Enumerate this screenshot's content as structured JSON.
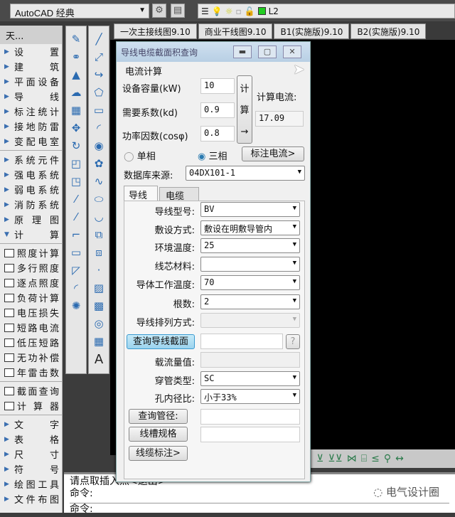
{
  "toolbar": {
    "workspace": "AutoCAD 经典",
    "layer": "L2",
    "icons": [
      "gear-icon",
      "workspace-icon",
      "layer-manager-icon",
      "bulb-icon",
      "sun-icon",
      "freeze-icon",
      "lock-icon",
      "color-swatch-icon"
    ],
    "layer_color": "#22cc22"
  },
  "tabs": [
    "一次主接线图9.10",
    "商业干线图9.10",
    "B1(实施版)9.10",
    "B2(实施版)9.10"
  ],
  "left_panel": {
    "title": "天...",
    "group1": [
      "设 置",
      "建 筑",
      "平面设备",
      "导 线",
      "标注统计",
      "接地防雷",
      "变配电室"
    ],
    "group2": [
      "系统元件",
      "强电系统",
      "弱电系统",
      "消防系统",
      "原 理 图"
    ],
    "calc": "计 算",
    "calc_items": [
      "照度计算",
      "多行照度",
      "逐点照度",
      "负荷计算",
      "电压损失",
      "短路电流",
      "低压短路",
      "无功补偿",
      "年雷击数"
    ],
    "calc_items2": [
      "截面查询",
      "计 算 器"
    ],
    "group3": [
      "文 字",
      "表 格",
      "尺 寸",
      "符 号",
      "绘图工具",
      "文件布图"
    ]
  },
  "dialog": {
    "title": "导线电缆截面积查询",
    "section": "电流计算",
    "capacity_label": "设备容量(kW)",
    "capacity": "10",
    "demand_label": "需要系数(kd)",
    "demand": "0.9",
    "pf_label": "功率因数(cosφ)",
    "pf": "0.8",
    "calc_button": [
      "计",
      "算",
      "→"
    ],
    "result_label": "计算电流:",
    "result": "17.09",
    "single_phase": "单相",
    "three_phase": "三相",
    "phase_selected": "三相",
    "annotate_current": "标注电流>",
    "db_label": "数据库来源:",
    "db": "04DX101-1",
    "tab_wire": "导线",
    "tab_cable": "电缆",
    "rows": [
      {
        "label": "导线型号:",
        "value": "BV"
      },
      {
        "label": "敷设方式:",
        "value": "敷设在明敷导管内"
      },
      {
        "label": "环境温度:",
        "value": "25"
      },
      {
        "label": "线芯材料:",
        "value": ""
      },
      {
        "label": "导体工作温度:",
        "value": "70"
      },
      {
        "label": "根数:",
        "value": "2"
      },
      {
        "label": "导线排列方式:",
        "value": ""
      }
    ],
    "query_section": "查询导线截面",
    "help": "?",
    "ampacity_label": "载流量值:",
    "pipe_type_label": "穿管类型:",
    "pipe_type": "SC",
    "ratio_label": "孔内径比:",
    "ratio": "小于33%",
    "query_pipe": "查询管径:",
    "trunking": "线槽规格",
    "cable_note": "线缆标注>"
  },
  "command": {
    "line1": "请点取插入点<退出>",
    "line2": "命令:",
    "line3": "命令:"
  },
  "watermark": "电气设计圈"
}
